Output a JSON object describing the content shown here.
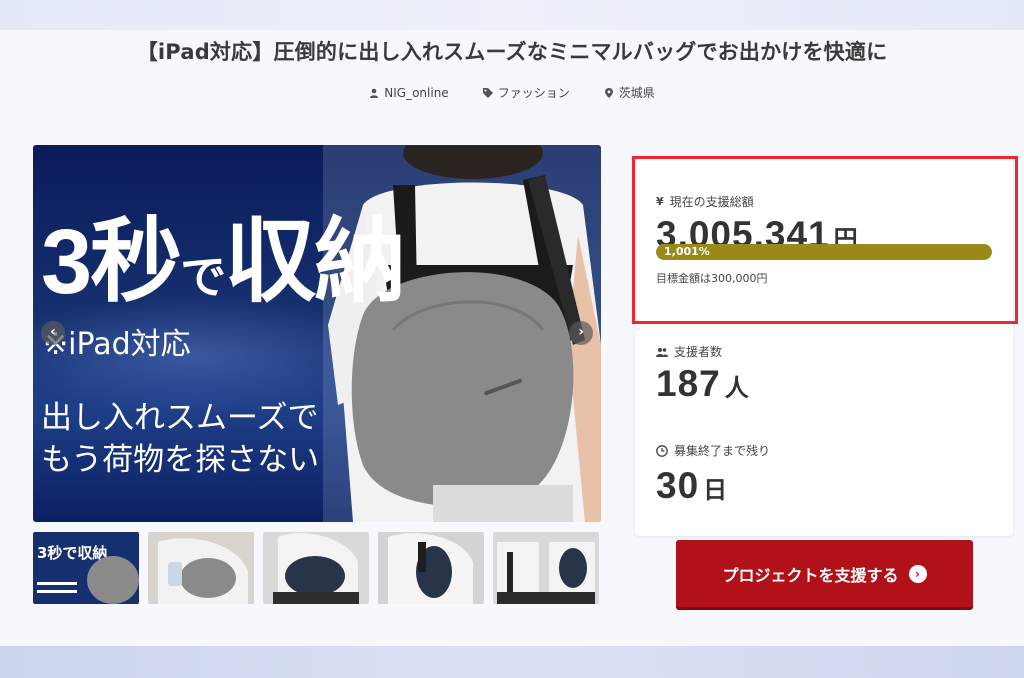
{
  "project": {
    "title": "【iPad対応】圧倒的に出し入れスムーズなミニマルバッグでお出かけを快適に",
    "owner": "NIG_online",
    "category": "ファッション",
    "location": "茨城県"
  },
  "hero": {
    "headline_num": "3",
    "headline_byou": "秒",
    "headline_de": "で",
    "headline_rest": "収納",
    "ipad_note": "※iPad対応",
    "copy_line1": "出し入れスムーズで",
    "copy_line2": "もう荷物を探さない",
    "prev_icon": "chevron-left-icon",
    "next_icon": "chevron-right-icon"
  },
  "thumbnails": [
    {
      "label": "3秒で収納"
    },
    {
      "label": ""
    },
    {
      "label": ""
    },
    {
      "label": ""
    },
    {
      "label": ""
    }
  ],
  "stats": {
    "total_label": "現在の支援総額",
    "total_value": "3,005,341",
    "total_unit": "円",
    "progress_text": "1,001%",
    "progress_fraction": 1.0,
    "goal_text": "目標金額は300,000円",
    "backers_label": "支援者数",
    "backers_value": "187",
    "backers_unit": "人",
    "remaining_label": "募集終了まで残り",
    "remaining_value": "30",
    "remaining_unit": "日"
  },
  "cta": {
    "label": "プロジェクトを支援する"
  },
  "colors": {
    "progress": "#9a8a1a",
    "cta": "#b1121a",
    "highlight": "#f4252e"
  }
}
